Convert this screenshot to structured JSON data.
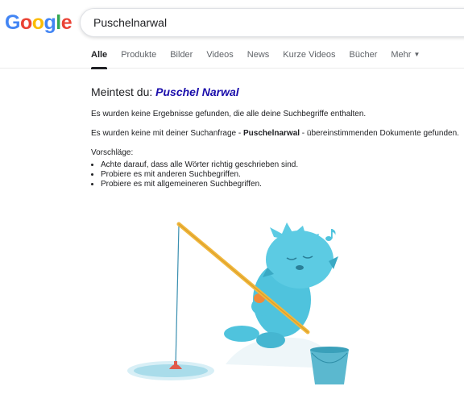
{
  "logo": {
    "text": "Google",
    "letters": [
      "G",
      "o",
      "o",
      "g",
      "l",
      "e"
    ]
  },
  "search": {
    "value": "Puschelnarwal"
  },
  "tabs": [
    {
      "label": "Alle",
      "active": true
    },
    {
      "label": "Produkte"
    },
    {
      "label": "Bilder"
    },
    {
      "label": "Videos"
    },
    {
      "label": "News"
    },
    {
      "label": "Kurze Videos"
    },
    {
      "label": "Bücher"
    },
    {
      "label": "Mehr"
    }
  ],
  "did_you_mean": {
    "prefix": "Meintest du:",
    "suggestion": "Puschel Narwal"
  },
  "messages": {
    "no_results": "Es wurden keine Ergebnisse gefunden, die alle deine Suchbegriffe enthalten.",
    "no_docs_prefix": "Es wurden keine mit deiner Suchanfrage - ",
    "no_docs_query": "Puschelnarwal",
    "no_docs_suffix": " - übereinstimmenden Dokumente gefunden.",
    "suggestions_title": "Vorschläge:"
  },
  "suggestions": [
    "Achte darauf, dass alle Wörter richtig geschrieben sind.",
    "Probiere es mit anderen Suchbegriffen.",
    "Probiere es mit allgemeineren Suchbegriffen."
  ],
  "colors": {
    "logo_blue": "#4285f4",
    "logo_red": "#ea4335",
    "logo_yellow": "#fbbc05",
    "logo_green": "#34a853",
    "link": "#1a0dab",
    "monster": "#4fc3dd",
    "bucket": "#5bb8cf"
  }
}
